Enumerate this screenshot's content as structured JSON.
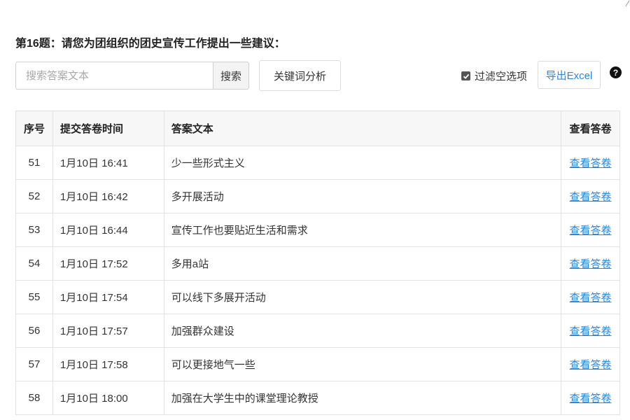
{
  "question": {
    "title": "第16题：请您为团组织的团史宣传工作提出一些建议："
  },
  "toolbar": {
    "search_placeholder": "搜索答案文本",
    "search_label": "搜索",
    "keyword_label": "关键词分析",
    "filter_label": "过滤空选项",
    "filter_checked": true,
    "export_label": "导出Excel",
    "help_symbol": "?"
  },
  "corner_mark": "⁄",
  "table": {
    "headers": {
      "seq": "序号",
      "time": "提交答卷时间",
      "answer": "答案文本",
      "view": "查看答卷"
    },
    "rows": [
      {
        "seq": "51",
        "time": "1月10日 16:41",
        "answer": "少一些形式主义",
        "view": "查看答卷"
      },
      {
        "seq": "52",
        "time": "1月10日 16:42",
        "answer": "多开展活动",
        "view": "查看答卷"
      },
      {
        "seq": "53",
        "time": "1月10日 16:44",
        "answer": "宣传工作也要贴近生活和需求",
        "view": "查看答卷"
      },
      {
        "seq": "54",
        "time": "1月10日 17:52",
        "answer": "多用a站",
        "view": "查看答卷"
      },
      {
        "seq": "55",
        "time": "1月10日 17:54",
        "answer": "可以线下多展开活动",
        "view": "查看答卷"
      },
      {
        "seq": "56",
        "time": "1月10日 17:57",
        "answer": "加强群众建设",
        "view": "查看答卷"
      },
      {
        "seq": "57",
        "time": "1月10日 17:58",
        "answer": "可以更接地气一些",
        "view": "查看答卷"
      },
      {
        "seq": "58",
        "time": "1月10日 18:00",
        "answer": "加强在大学生中的课堂理论教授",
        "view": "查看答卷"
      }
    ]
  },
  "colors": {
    "link": "#2f86d6",
    "header_bg": "#f7f7f7",
    "border": "#e3e3e3"
  }
}
